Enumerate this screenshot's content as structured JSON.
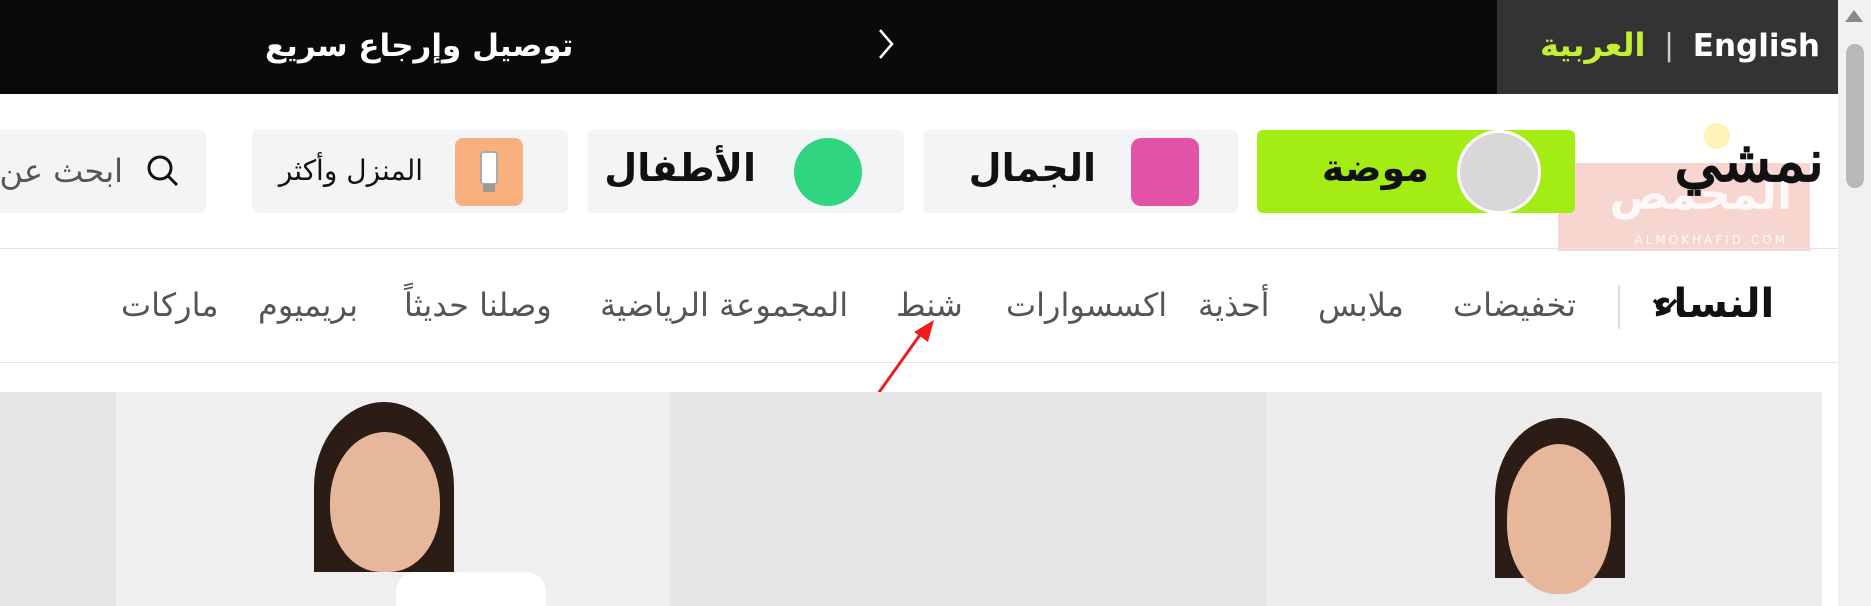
{
  "announcement": {
    "message": "توصيل وإرجاع سريع"
  },
  "language": {
    "english_label": "English",
    "arabic_label": "العربية",
    "separator": "|"
  },
  "logo": {
    "text": "نمشي"
  },
  "watermark": {
    "arabic": "المحمص",
    "english": "ALMOKHAFID.COM"
  },
  "categories": [
    {
      "label": "موضة",
      "active": true
    },
    {
      "label": "الجمال",
      "active": false
    },
    {
      "label": "الأطفال",
      "active": false
    },
    {
      "label": "المنزل وأكثر",
      "active": false
    }
  ],
  "search": {
    "placeholder": "ابحث عن"
  },
  "subnav": {
    "department": "النساء",
    "items": [
      "تخفيضات",
      "ملابس",
      "أحذية",
      "اكسسوارات",
      "شنط",
      "المجموعة الرياضية",
      "وصلنا حديثاً",
      "بريميوم",
      "ماركات"
    ]
  },
  "colors": {
    "accent": "#a3ec14",
    "topbar": "#0a0a0a",
    "lang_active": "#c3f033",
    "annotation": "#ee1c1c"
  }
}
